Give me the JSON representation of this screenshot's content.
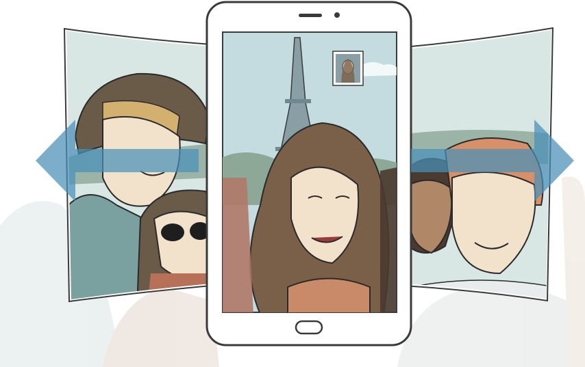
{
  "illustration": {
    "scene": "wide-selfie-panorama",
    "landmark_icon": "eiffel-tower-icon",
    "pan_left_icon": "arrow-left-icon",
    "pan_right_icon": "arrow-right-icon",
    "preview_thumbnail_icon": "selfie-thumbnail-icon",
    "home_button_icon": "home-button-icon"
  },
  "colors": {
    "arrow": "#4a90b8",
    "tablet_frame": "#ffffff",
    "tablet_outline": "#3a3a3a",
    "sky": "#c4dce0",
    "panel_sky": "#d8e6e4",
    "skin": "#f2e2cc",
    "hair_brown": "#7a6048",
    "hair_blond": "#d4b070",
    "hat": "#6a5a48",
    "shirt_teal": "#7aa0a0",
    "shirt_orange": "#c88a68",
    "shirt_white": "#e8ecec"
  }
}
